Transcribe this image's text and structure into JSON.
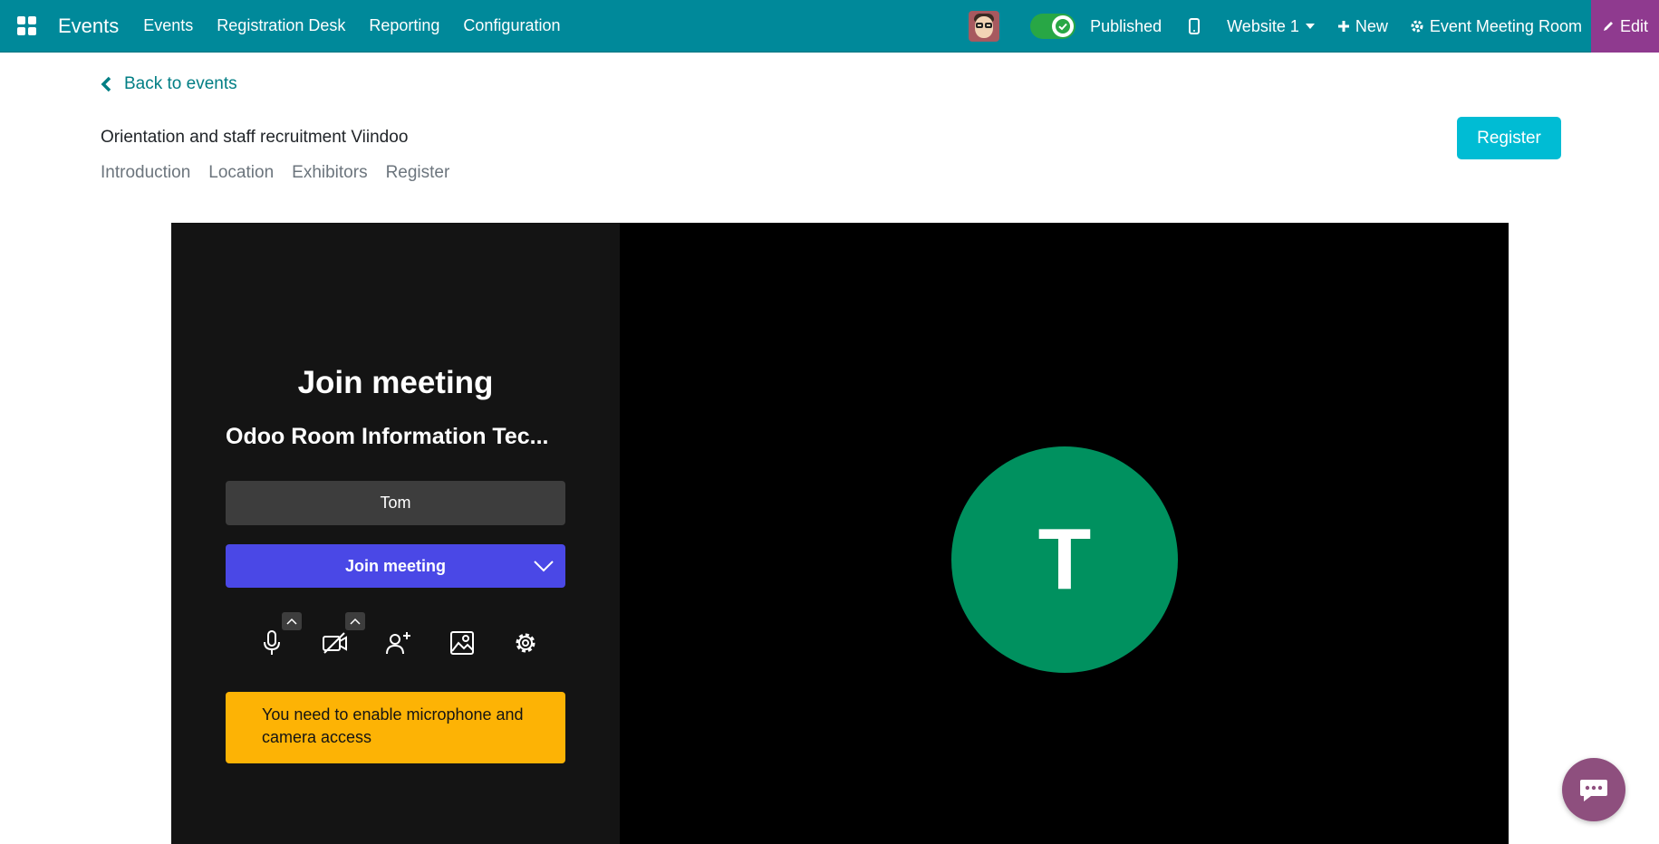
{
  "navbar": {
    "app_name": "Events",
    "menu": [
      "Events",
      "Registration Desk",
      "Reporting",
      "Configuration"
    ],
    "published_label": "Published",
    "website_label": "Website 1",
    "new_label": "New",
    "room_label": "Event Meeting Room",
    "edit_label": "Edit",
    "accent_color": "#00899a"
  },
  "header": {
    "back_label": "Back to events",
    "event_title": "Orientation and staff recruitment Viindoo",
    "tabs": [
      "Introduction",
      "Location",
      "Exhibitors",
      "Register"
    ],
    "register_button": "Register"
  },
  "meeting": {
    "title": "Join meeting",
    "room_name": "Odoo Room Information Tec...",
    "display_name": "Tom",
    "join_button": "Join meeting",
    "warning": "You need to enable microphone and camera access",
    "avatar_initial": "T",
    "controls": [
      "microphone-icon",
      "camera-off-icon",
      "invite-icon",
      "background-icon",
      "settings-icon"
    ]
  }
}
